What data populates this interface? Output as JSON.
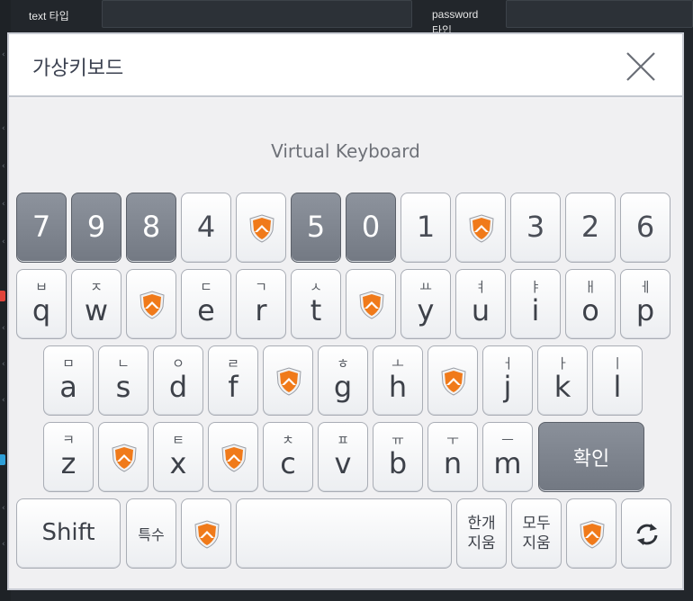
{
  "background": {
    "text_label": "text 타입",
    "password_label": "password",
    "password_label_line2": "타입"
  },
  "dialog": {
    "title": "가상키보드",
    "subtitle": "Virtual Keyboard",
    "close_icon": "close-x-icon"
  },
  "keyboard": {
    "row1": [
      {
        "label": "7",
        "dark": true
      },
      {
        "label": "9",
        "dark": true
      },
      {
        "label": "8",
        "dark": true
      },
      {
        "label": "4",
        "dark": false
      },
      {
        "label": "",
        "shield": true
      },
      {
        "label": "5",
        "dark": true
      },
      {
        "label": "0",
        "dark": true
      },
      {
        "label": "1",
        "dark": false
      },
      {
        "label": "",
        "shield": true
      },
      {
        "label": "3",
        "dark": false
      },
      {
        "label": "2",
        "dark": false
      },
      {
        "label": "6",
        "dark": false
      }
    ],
    "row2": [
      {
        "kor": "ㅂ",
        "lat": "q"
      },
      {
        "kor": "ㅈ",
        "lat": "w"
      },
      {
        "shield": true
      },
      {
        "kor": "ㄷ",
        "lat": "e"
      },
      {
        "kor": "ㄱ",
        "lat": "r"
      },
      {
        "kor": "ㅅ",
        "lat": "t"
      },
      {
        "shield": true
      },
      {
        "kor": "ㅛ",
        "lat": "y"
      },
      {
        "kor": "ㅕ",
        "lat": "u"
      },
      {
        "kor": "ㅑ",
        "lat": "i"
      },
      {
        "kor": "ㅐ",
        "lat": "o"
      },
      {
        "kor": "ㅔ",
        "lat": "p"
      }
    ],
    "row3": [
      {
        "kor": "ㅁ",
        "lat": "a"
      },
      {
        "kor": "ㄴ",
        "lat": "s"
      },
      {
        "kor": "ㅇ",
        "lat": "d"
      },
      {
        "kor": "ㄹ",
        "lat": "f"
      },
      {
        "shield": true
      },
      {
        "kor": "ㅎ",
        "lat": "g"
      },
      {
        "kor": "ㅗ",
        "lat": "h"
      },
      {
        "shield": true
      },
      {
        "kor": "ㅓ",
        "lat": "j"
      },
      {
        "kor": "ㅏ",
        "lat": "k"
      },
      {
        "kor": "ㅣ",
        "lat": "l"
      }
    ],
    "row4": [
      {
        "kor": "ㅋ",
        "lat": "z"
      },
      {
        "shield": true
      },
      {
        "kor": "ㅌ",
        "lat": "x"
      },
      {
        "shield": true
      },
      {
        "kor": "ㅊ",
        "lat": "c"
      },
      {
        "kor": "ㅍ",
        "lat": "v"
      },
      {
        "kor": "ㅠ",
        "lat": "b"
      },
      {
        "kor": "ㅜ",
        "lat": "n"
      },
      {
        "kor": "ㅡ",
        "lat": "m"
      }
    ],
    "confirm_label": "확인",
    "shift_label": "Shift",
    "special_label": "특수",
    "delete_one_line1": "한개",
    "delete_one_line2": "지움",
    "delete_all_line1": "모두",
    "delete_all_line2": "지움",
    "shield_icon": "security-shield-icon",
    "refresh_icon": "refresh-icon"
  },
  "colors": {
    "dark_key": "#7e848e",
    "shield_orange": "#f07a1a",
    "background": "#22262b"
  }
}
